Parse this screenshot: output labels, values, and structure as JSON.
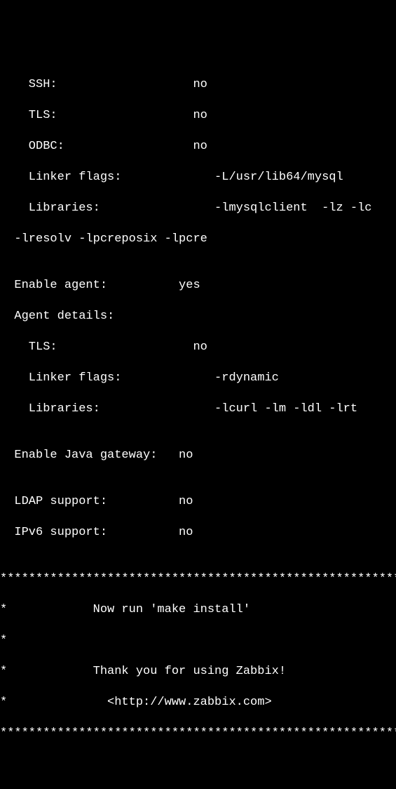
{
  "terminal": {
    "lines": [
      "    SSH:                   no",
      "    TLS:                   no",
      "    ODBC:                  no",
      "    Linker flags:             -L/usr/lib64/mysql",
      "    Libraries:                -lmysqlclient  -lz -lc",
      "  -lresolv -lpcreposix -lpcre",
      "",
      "  Enable agent:          yes",
      "  Agent details:",
      "    TLS:                   no",
      "    Linker flags:             -rdynamic",
      "    Libraries:                -lcurl -lm -ldl -lrt",
      "",
      "  Enable Java gateway:   no",
      "",
      "  LDAP support:          no",
      "  IPv6 support:          no",
      "",
      "***********************************************************",
      "*            Now run 'make install'",
      "*",
      "*            Thank you for using Zabbix!",
      "*              <http://www.zabbix.com>",
      "***********************************************************"
    ]
  }
}
